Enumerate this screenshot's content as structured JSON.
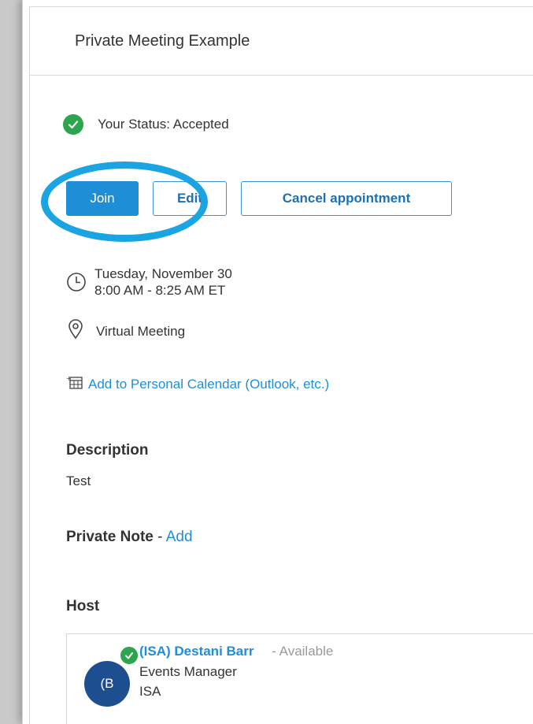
{
  "meeting": {
    "title": "Private Meeting Example"
  },
  "status": {
    "text": "Your Status: Accepted"
  },
  "actions": {
    "join_label": "Join",
    "edit_label": "Edit",
    "cancel_label": "Cancel appointment"
  },
  "schedule": {
    "date": "Tuesday, November 30",
    "time": "8:00 AM - 8:25 AM ET"
  },
  "location": {
    "text": "Virtual Meeting"
  },
  "calendar": {
    "link_label": "Add to Personal Calendar (Outlook, etc.)"
  },
  "description": {
    "heading": "Description",
    "text": "Test"
  },
  "private_note": {
    "heading": "Private Note",
    "separator": " - ",
    "add_label": "Add"
  },
  "host": {
    "heading": "Host",
    "avatar_initials": "(B",
    "name": "(ISA) Destani Barr",
    "availability": "- Available",
    "role": "Events Manager",
    "org": "ISA"
  },
  "colors": {
    "accent": "#1e8fd6",
    "success": "#2da44e",
    "highlight": "#1aa4e2",
    "avatar": "#1d4e8f"
  },
  "icons": [
    "check-circle-icon",
    "clock-icon",
    "location-pin-icon",
    "calendar-add-icon"
  ]
}
